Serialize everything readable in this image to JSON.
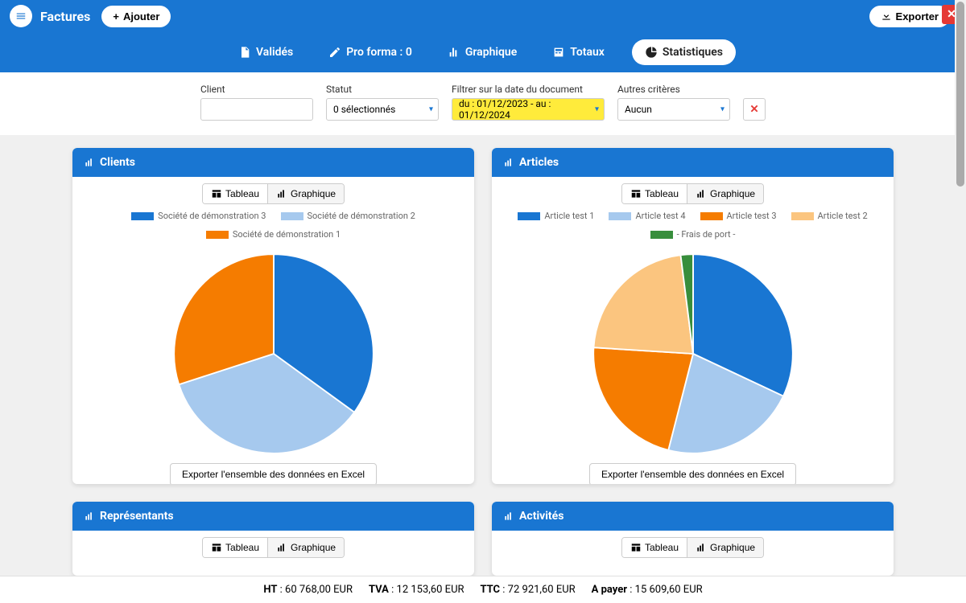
{
  "header": {
    "title": "Factures",
    "add_label": "Ajouter",
    "export_label": "Exporter"
  },
  "tabs": {
    "valides": "Validés",
    "proforma": "Pro forma : 0",
    "graphique": "Graphique",
    "totaux": "Totaux",
    "statistiques": "Statistiques"
  },
  "filters": {
    "client_label": "Client",
    "client_value": "",
    "statut_label": "Statut",
    "statut_value": "0 sélectionnés",
    "date_label": "Filtrer sur la date du document",
    "date_value": "du : 01/12/2023 - au : 01/12/2024",
    "autres_label": "Autres critères",
    "autres_value": "Aucun"
  },
  "cards": {
    "clients": {
      "title": "Clients"
    },
    "articles": {
      "title": "Articles"
    },
    "representants": {
      "title": "Représentants"
    },
    "activites": {
      "title": "Activités"
    }
  },
  "toggle": {
    "tableau": "Tableau",
    "graphique": "Graphique"
  },
  "export_data_label": "Exporter l'ensemble des données en Excel",
  "footer": {
    "ht_label": "HT",
    "ht_value": "60 768,00 EUR",
    "tva_label": "TVA",
    "tva_value": "12 153,60 EUR",
    "ttc_label": "TTC",
    "ttc_value": "72 921,60 EUR",
    "apayer_label": "A payer",
    "apayer_value": "15 609,60 EUR"
  },
  "colors": {
    "c1": "#1976d2",
    "c2": "#a6c9ee",
    "c3": "#f57c00",
    "c4": "#fbc57f",
    "c5": "#388e3c"
  },
  "chart_data": [
    {
      "type": "pie",
      "title": "Clients",
      "series": [
        {
          "name": "Société de démonstration 3",
          "value": 35,
          "color": "#1976d2"
        },
        {
          "name": "Société de démonstration 2",
          "value": 35,
          "color": "#a6c9ee"
        },
        {
          "name": "Société de démonstration 1",
          "value": 30,
          "color": "#f57c00"
        }
      ]
    },
    {
      "type": "pie",
      "title": "Articles",
      "series": [
        {
          "name": "Article test 1",
          "value": 32,
          "color": "#1976d2"
        },
        {
          "name": "Article test 4",
          "value": 22,
          "color": "#a6c9ee"
        },
        {
          "name": "Article test 3",
          "value": 22,
          "color": "#f57c00"
        },
        {
          "name": "Article test 2",
          "value": 22,
          "color": "#fbc57f"
        },
        {
          "name": "- Frais de port -",
          "value": 2,
          "color": "#388e3c"
        }
      ]
    }
  ]
}
